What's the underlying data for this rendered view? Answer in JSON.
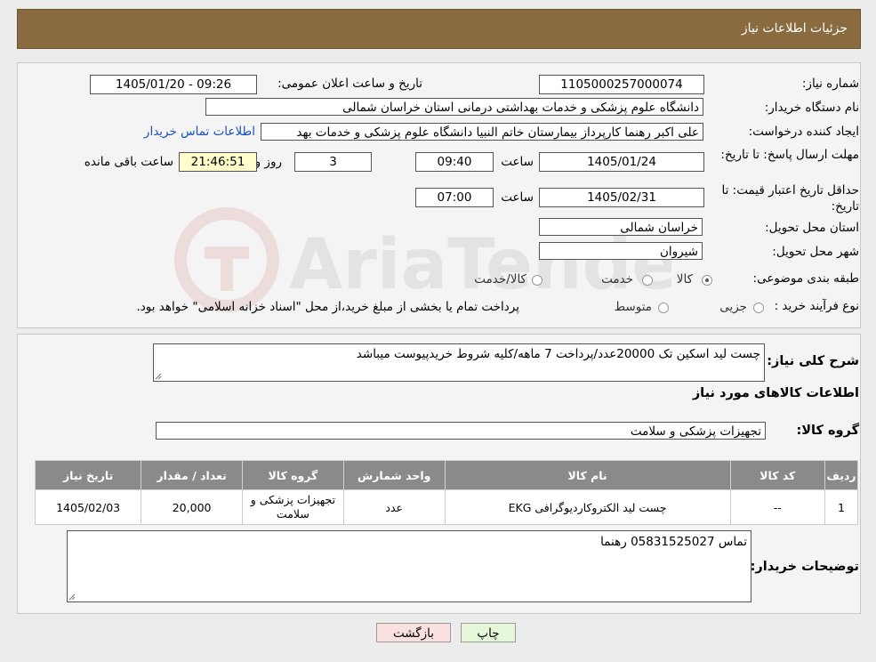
{
  "header": {
    "title": "جزئیات اطلاعات نیاز"
  },
  "form": {
    "need_number_label": "شماره نیاز:",
    "need_number": "1105000257000074",
    "announce_label": "تاریخ و ساعت اعلان عمومی:",
    "announce_value": "1405/01/20 - 09:26",
    "buyer_org_label": "نام دستگاه خریدار:",
    "buyer_org": "دانشگاه علوم پزشکی و خدمات بهداشتی درمانی استان خراسان شمالی",
    "requester_label": "ایجاد کننده درخواست:",
    "requester": "علی اکبر رهنما کارپرداز بیمارستان خاتم النبیا دانشگاه علوم پزشکی و خدمات بهد",
    "buyer_contact_link": "اطلاعات تماس خریدار",
    "deadline_label": "مهلت ارسال پاسخ: تا تاریخ:",
    "deadline_date": "1405/01/24",
    "time_label": "ساعت",
    "deadline_time": "09:40",
    "days_value": "3",
    "days_label": "روز و",
    "remaining_time": "21:46:51",
    "remaining_label": "ساعت باقی مانده",
    "price_validity_label": "حداقل تاریخ اعتبار قیمت: تا تاریخ:",
    "price_validity_date": "1405/02/31",
    "price_validity_time": "07:00",
    "province_label": "استان محل تحویل:",
    "province": "خراسان شمالی",
    "city_label": "شهر محل تحویل:",
    "city": "شیروان",
    "category_label": "طبقه بندی موضوعی:",
    "category_options": [
      "کالا",
      "خدمت",
      "کالا/خدمت"
    ],
    "category_selected": "کالا",
    "process_label": "نوع فرآیند خرید :",
    "process_options": [
      "جزیی",
      "متوسط"
    ],
    "process_note": "پرداخت تمام یا بخشی از مبلغ خرید،از محل \"اسناد خزانه اسلامی\" خواهد بود."
  },
  "summary": {
    "label": "شرح کلی نیاز:",
    "value": "چست لید اسکین تک 20000عدد/پرداخت 7 ماهه/کلیه شروط خریدپیوست میباشد",
    "goods_info_title": "اطلاعات کالاهای مورد نیاز",
    "goods_group_label": "گروه کالا:",
    "goods_group_value": "تجهیزات پزشکی و سلامت"
  },
  "table": {
    "headers": [
      "ردیف",
      "کد کالا",
      "نام کالا",
      "واحد شمارش",
      "گروه کالا",
      "تعداد / مقدار",
      "تاریخ نیاز"
    ],
    "rows": [
      [
        "1",
        "--",
        "چست لید الکتروکاردیوگرافی EKG",
        "عدد",
        "تجهیزات پزشکی و سلامت",
        "20,000",
        "1405/02/03"
      ]
    ]
  },
  "buyer_notes": {
    "label": "توضیحات خریدار:",
    "value": "تماس 05831525027 رهنما"
  },
  "buttons": {
    "print": "چاپ",
    "back": "بازگشت"
  },
  "watermark": {
    "text": "AriaTender.neT"
  },
  "colors": {
    "header_bg": "#8a6a3f",
    "table_header_bg": "#8a8a8a",
    "link": "#1a4fbf",
    "print_btn": "#e6f7d9",
    "back_btn": "#fbe0e0"
  }
}
